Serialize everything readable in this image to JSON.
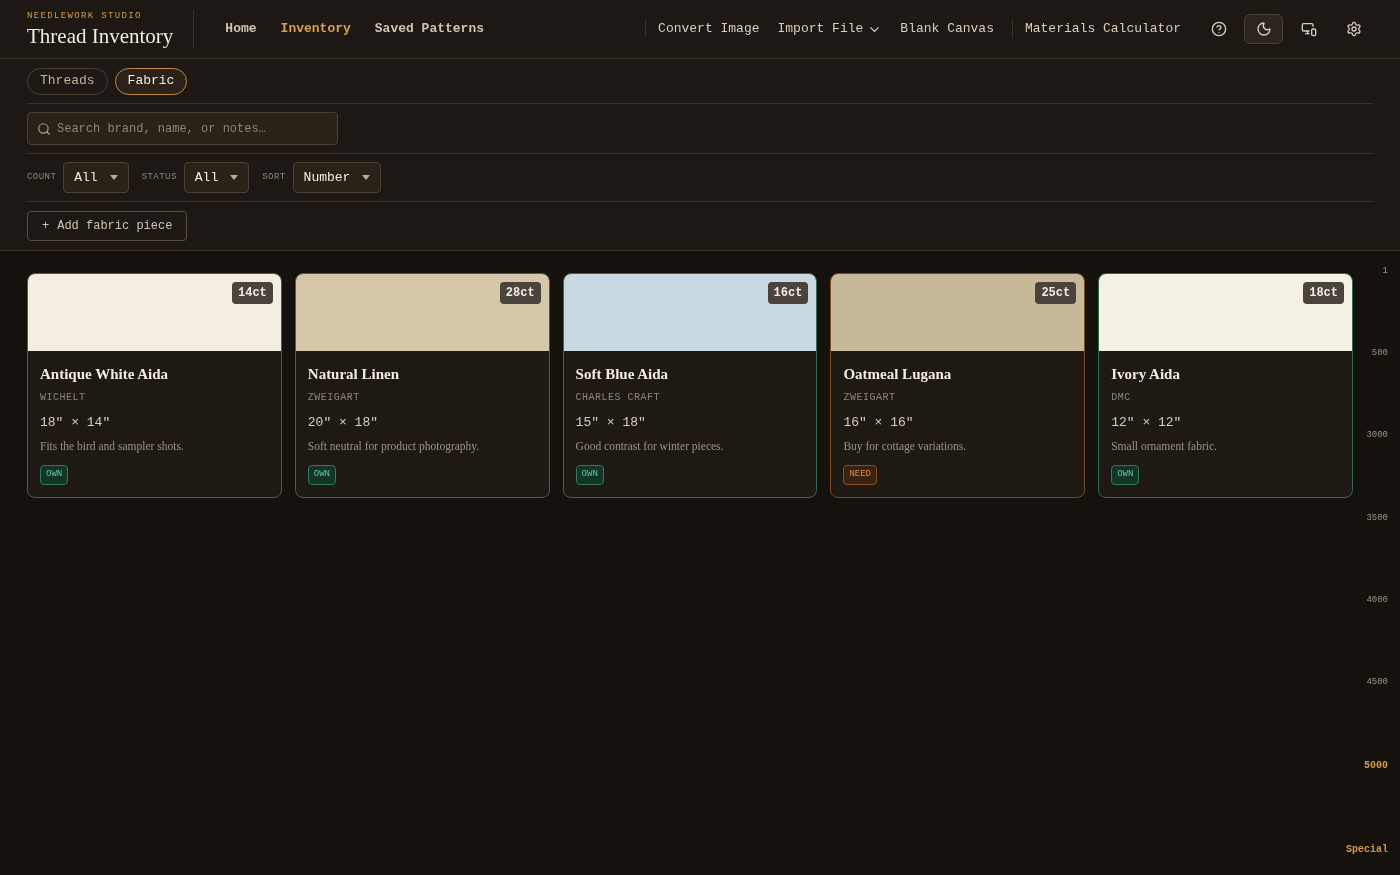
{
  "brand": {
    "eyebrow": "NEEDLEWORK STUDIO",
    "title": "Thread Inventory"
  },
  "nav": [
    {
      "label": "Home",
      "selected": false
    },
    {
      "label": "Inventory",
      "selected": true
    },
    {
      "label": "Saved Patterns",
      "selected": false
    }
  ],
  "actions": [
    {
      "label": "Convert Image",
      "kind": "link"
    },
    {
      "label": "Import File",
      "kind": "dropdown"
    },
    {
      "label": "Blank Canvas",
      "kind": "link"
    },
    {
      "label": "Materials Calculator",
      "kind": "link"
    }
  ],
  "icon_buttons": [
    {
      "kind": "help",
      "on": false
    },
    {
      "kind": "theme",
      "on": true
    },
    {
      "kind": "devices",
      "on": false
    },
    {
      "kind": "settings",
      "on": false
    }
  ],
  "tabs": [
    {
      "label": "Threads",
      "selected": false
    },
    {
      "label": "Fabric",
      "selected": true
    }
  ],
  "search": {
    "placeholder": "Search brand, name, or notes…"
  },
  "filters": [
    {
      "label": "COUNT",
      "value": "All"
    },
    {
      "label": "STATUS",
      "value": "All"
    },
    {
      "label": "SORT",
      "value": "Number"
    }
  ],
  "add_button": {
    "icon": "+",
    "label": "Add fabric piece"
  },
  "cards": [
    {
      "name": "Antique White Aida",
      "brand": "WICHELT",
      "size": "18\" × 14\"",
      "notes": "Fits the bird and sampler shots.",
      "count": "14ct",
      "status": "OWN",
      "kind": "own",
      "color": "#f3ede2"
    },
    {
      "name": "Natural Linen",
      "brand": "ZWEIGART",
      "size": "20\" × 18\"",
      "notes": "Soft neutral for product photography.",
      "count": "28ct",
      "status": "OWN",
      "kind": "own",
      "color": "#d6c7aa"
    },
    {
      "name": "Soft Blue Aida",
      "brand": "CHARLES CRAFT",
      "size": "15\" × 18\"",
      "notes": "Good contrast for winter pieces.",
      "count": "16ct",
      "status": "OWN",
      "kind": "own",
      "color": "#c8d9e2"
    },
    {
      "name": "Oatmeal Lugana",
      "brand": "ZWEIGART",
      "size": "16\" × 16\"",
      "notes": "Buy for cottage variations.",
      "count": "25ct",
      "status": "NEED",
      "kind": "need",
      "color": "#c8b99b"
    },
    {
      "name": "Ivory Aida",
      "brand": "DMC",
      "size": "12\" × 12\"",
      "notes": "Small ornament fabric.",
      "count": "18ct",
      "status": "OWN",
      "kind": "own",
      "color": "#f5f0e4"
    }
  ],
  "index_rail": [
    {
      "label": "1",
      "selected": false
    },
    {
      "label": "500",
      "selected": false
    },
    {
      "label": "3000",
      "selected": false
    },
    {
      "label": "3500",
      "selected": false
    },
    {
      "label": "4000",
      "selected": false
    },
    {
      "label": "4500",
      "selected": false
    },
    {
      "label": "5000",
      "selected": true
    },
    {
      "label": "Special",
      "selected": true
    }
  ]
}
